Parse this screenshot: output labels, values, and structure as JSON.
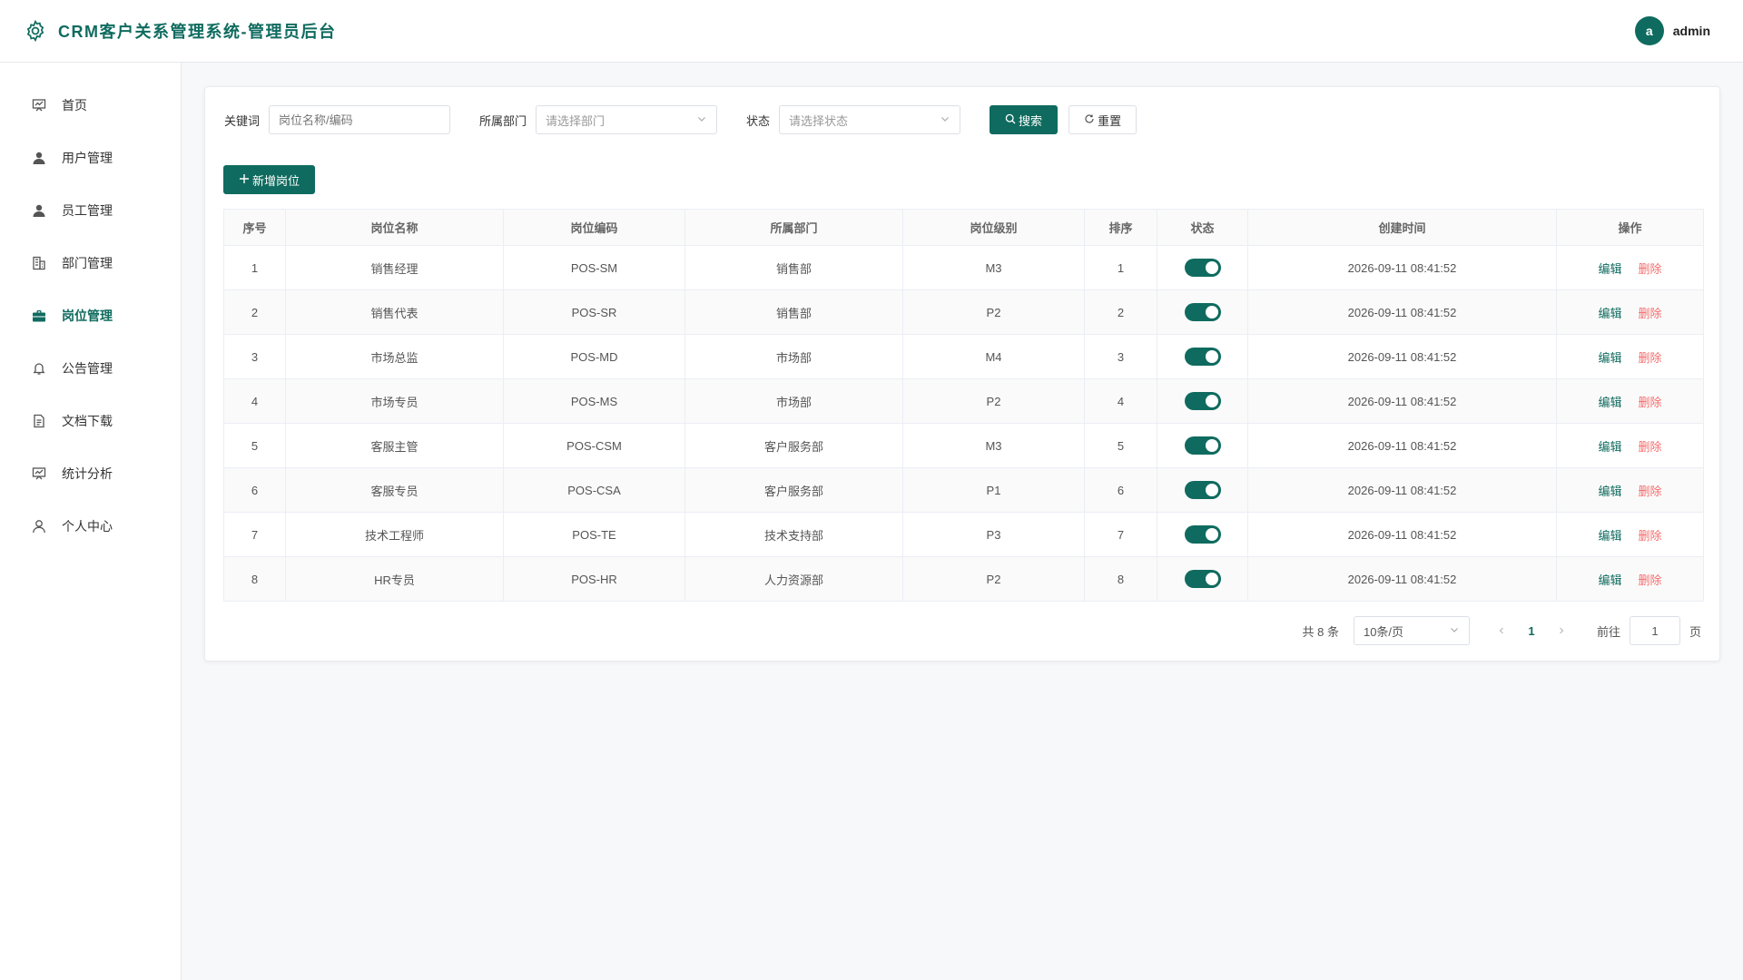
{
  "header": {
    "title": "CRM客户关系管理系统-管理员后台",
    "avatar_letter": "a",
    "username": "admin",
    "brand_icon": "gear-icon"
  },
  "sidebar": {
    "items": [
      {
        "label": "首页",
        "icon": "dashboard-icon",
        "active": false
      },
      {
        "label": "用户管理",
        "icon": "user-icon",
        "active": false
      },
      {
        "label": "员工管理",
        "icon": "user-icon",
        "active": false
      },
      {
        "label": "部门管理",
        "icon": "building-icon",
        "active": false
      },
      {
        "label": "岗位管理",
        "icon": "briefcase-icon",
        "active": true
      },
      {
        "label": "公告管理",
        "icon": "bell-icon",
        "active": false
      },
      {
        "label": "文档下载",
        "icon": "document-icon",
        "active": false
      },
      {
        "label": "统计分析",
        "icon": "chart-icon",
        "active": false
      },
      {
        "label": "个人中心",
        "icon": "user-outline-icon",
        "active": false
      }
    ]
  },
  "filters": {
    "keyword_label": "关键词",
    "keyword_placeholder": "岗位名称/编码",
    "dept_label": "所属部门",
    "dept_placeholder": "请选择部门",
    "status_label": "状态",
    "status_placeholder": "请选择状态",
    "search_label": "搜索",
    "reset_label": "重置"
  },
  "add_button_label": "新增岗位",
  "table": {
    "headers": [
      "序号",
      "岗位名称",
      "岗位编码",
      "所属部门",
      "岗位级别",
      "排序",
      "状态",
      "创建时间",
      "操作"
    ],
    "rows": [
      {
        "no": "1",
        "name": "销售经理",
        "code": "POS-SM",
        "dept": "销售部",
        "level": "M3",
        "sort": "1",
        "enabled": true,
        "created": "2026-09-11 08:41:52"
      },
      {
        "no": "2",
        "name": "销售代表",
        "code": "POS-SR",
        "dept": "销售部",
        "level": "P2",
        "sort": "2",
        "enabled": true,
        "created": "2026-09-11 08:41:52"
      },
      {
        "no": "3",
        "name": "市场总监",
        "code": "POS-MD",
        "dept": "市场部",
        "level": "M4",
        "sort": "3",
        "enabled": true,
        "created": "2026-09-11 08:41:52"
      },
      {
        "no": "4",
        "name": "市场专员",
        "code": "POS-MS",
        "dept": "市场部",
        "level": "P2",
        "sort": "4",
        "enabled": true,
        "created": "2026-09-11 08:41:52"
      },
      {
        "no": "5",
        "name": "客服主管",
        "code": "POS-CSM",
        "dept": "客户服务部",
        "level": "M3",
        "sort": "5",
        "enabled": true,
        "created": "2026-09-11 08:41:52"
      },
      {
        "no": "6",
        "name": "客服专员",
        "code": "POS-CSA",
        "dept": "客户服务部",
        "level": "P1",
        "sort": "6",
        "enabled": true,
        "created": "2026-09-11 08:41:52"
      },
      {
        "no": "7",
        "name": "技术工程师",
        "code": "POS-TE",
        "dept": "技术支持部",
        "level": "P3",
        "sort": "7",
        "enabled": true,
        "created": "2026-09-11 08:41:52"
      },
      {
        "no": "8",
        "name": "HR专员",
        "code": "POS-HR",
        "dept": "人力资源部",
        "level": "P2",
        "sort": "8",
        "enabled": true,
        "created": "2026-09-11 08:41:52"
      }
    ],
    "edit_label": "编辑",
    "delete_label": "删除"
  },
  "pagination": {
    "total_text": "共 8 条",
    "page_size": "10条/页",
    "current_page": "1",
    "goto_label": "前往",
    "goto_value": "1",
    "page_suffix": "页"
  },
  "colors": {
    "primary": "#0f6b5f",
    "danger": "#f56c6c"
  }
}
